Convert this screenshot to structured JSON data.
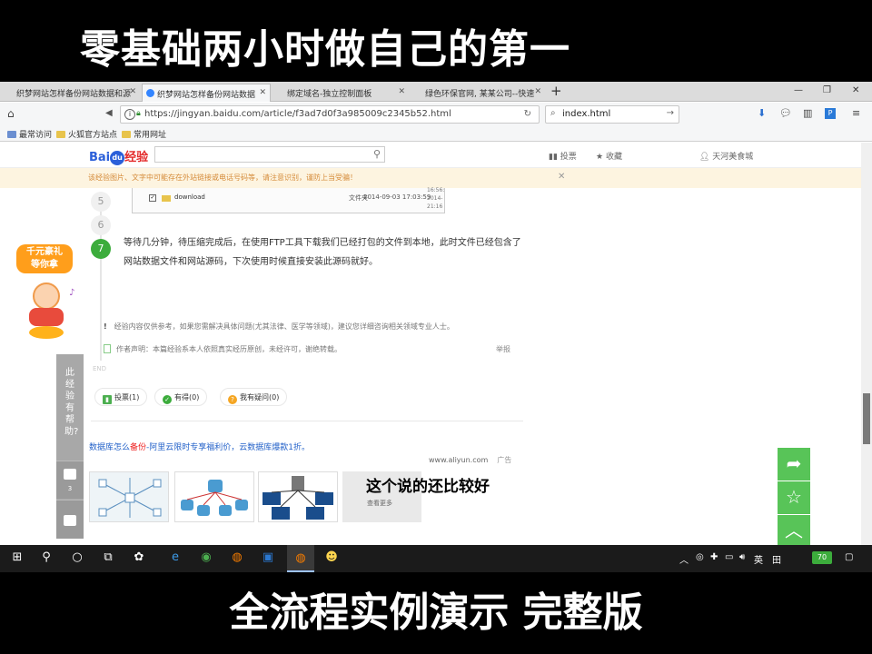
{
  "captions": {
    "top": "零基础两小时做自己的第一",
    "bottom": "全流程实例演示 完整版"
  },
  "browser": {
    "tabs": [
      {
        "label": "织梦网站怎样备份网站数据和源"
      },
      {
        "label": "织梦网站怎样备份网站数据"
      },
      {
        "label": "绑定域名-独立控制面板"
      },
      {
        "label": "绿色环保官网, 某某公司--快速"
      }
    ],
    "url": "https://jingyan.baidu.com/article/f3ad7d0f3a985009c2345b52.html",
    "search_value": "index.html",
    "bookmarks": [
      "最常访问",
      "火狐官方站点",
      "常用网址"
    ]
  },
  "site": {
    "logo": {
      "bai": "Bai",
      "du": "du",
      "jy": "经验"
    },
    "nav": {
      "vote": "投票",
      "fav": "收藏",
      "user": "天河美食城"
    },
    "notice": "该经验图片、文字中可能存在外站链接或电话号码等，请注意识别，谨防上当受骗！"
  },
  "steps": {
    "prev": [
      "5",
      "6"
    ],
    "current": "7",
    "end_label": "END",
    "text": "等待几分钟，待压缩完成后，在使用FTP工具下载我们已经打包的文件到本地，此时文件已经包含了网站数据文件和网站源码，下次使用时候直接安装此源码就好。"
  },
  "file_shot": {
    "name": "download",
    "type": "文件夹",
    "date": "2014-09-03 17:03:59",
    "extra_top": "16:56:",
    "extra_mid": "2014-",
    "extra_bot": "21:16"
  },
  "disclaimer": "经验内容仅供参考，如果您需解决具体问题(尤其法律、医学等领域)，建议您详细咨询相关领域专业人士。",
  "author_note": "作者声明：本篇经验系本人依照真实经历原创，未经许可，谢绝转载。",
  "report_label": "举报",
  "votes": [
    {
      "label": "投票(1)"
    },
    {
      "label": "有得(0)"
    },
    {
      "label": "我有疑问(0)"
    }
  ],
  "ad": {
    "title_prefix": "数据库怎么",
    "title_red": "备份",
    "title_rest": "-阿里云限时专享福利价，云数据库爆款1折。",
    "source": "www.aliyun.com",
    "tag": "广告",
    "card_more": "查看更多"
  },
  "overlay_caption": "这个说的还比较好",
  "promo": {
    "line1": "千元豪礼",
    "line2": "等你拿"
  },
  "helpful": {
    "question": "此经验有帮助?",
    "up_count": "3"
  },
  "taskbar": {
    "tray": [
      "英",
      "田"
    ],
    "badge": "70"
  },
  "colors": {
    "accent_green": "#58c458",
    "baidu_blue": "#2b5fd9",
    "notice_orange": "#d58b3a"
  }
}
